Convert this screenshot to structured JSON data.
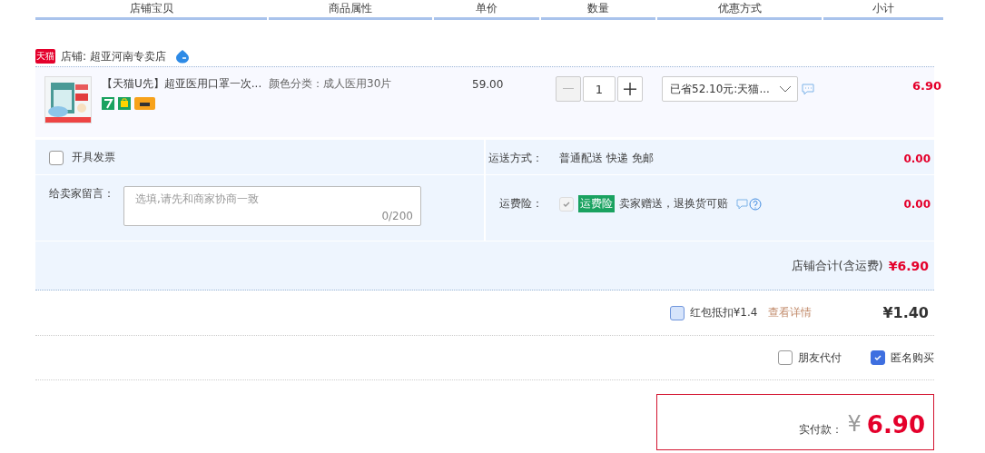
{
  "table": {
    "columns": [
      "店铺宝贝",
      "商品属性",
      "单价",
      "数量",
      "优惠方式",
      "小计"
    ]
  },
  "shop": {
    "badge": "天猫",
    "label": "店铺: 超亚河南专卖店"
  },
  "item": {
    "title": "【天猫U先】超亚医用口罩一次...",
    "attribute": "颜色分类：成人医用30片",
    "price": "59.00",
    "quantity": "1",
    "minus_disabled": true,
    "promo": "已省52.10元:天猫...",
    "subtotal": "6.90"
  },
  "invoice": {
    "label": "开具发票",
    "checked": false
  },
  "shipping": {
    "label": "运送方式：",
    "value": "普通配送 快递 免邮",
    "amount": "0.00"
  },
  "message": {
    "label": "给卖家留言：",
    "placeholder": "选填,请先和商家协商一致",
    "counter": "0/200"
  },
  "insurance": {
    "label": "运费险：",
    "checked": true,
    "disabled": true,
    "tag": "运费险",
    "text": "卖家赠送，退换货可赔",
    "amount": "0.00"
  },
  "shop_total": {
    "label": "店铺合计(含运费)",
    "amount": "¥6.90"
  },
  "red_packet": {
    "checked": false,
    "label": "红包抵扣¥1.4",
    "link": "查看详情",
    "amount": "¥1.40"
  },
  "options": [
    {
      "label": "朋友代付",
      "checked": false
    },
    {
      "label": "匿名购买",
      "checked": true
    }
  ],
  "payment": {
    "label": "实付款：",
    "currency": "¥",
    "amount": "6.90"
  }
}
